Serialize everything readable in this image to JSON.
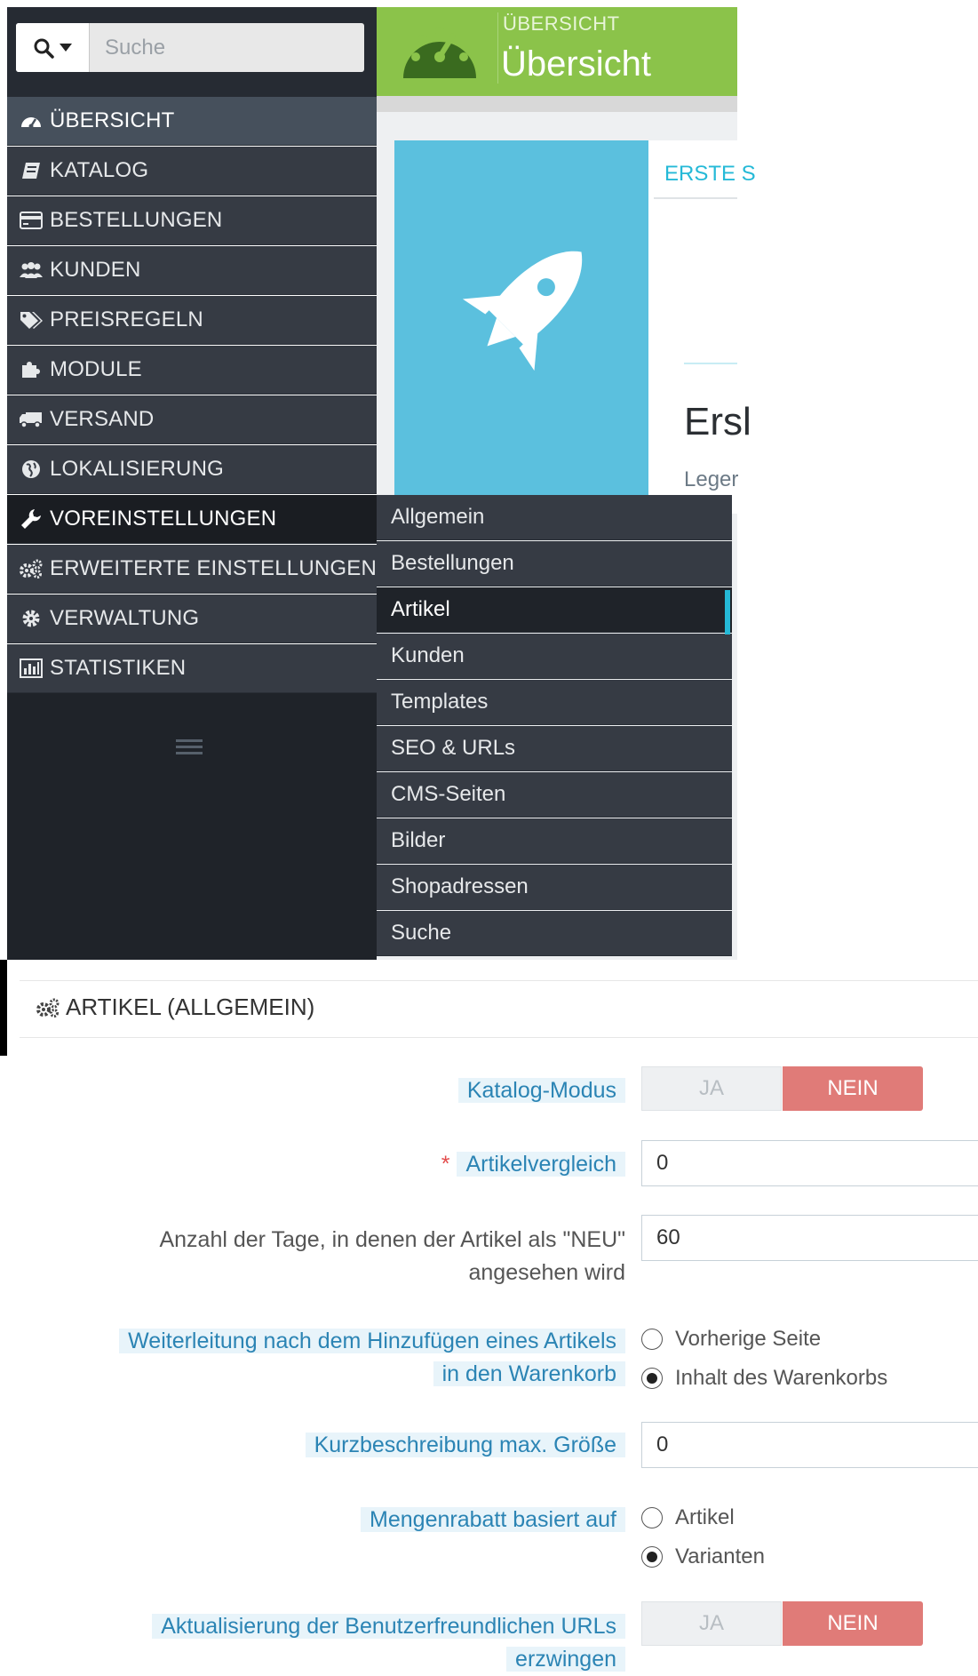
{
  "search": {
    "placeholder": "Suche"
  },
  "nav": {
    "items": [
      {
        "label": "ÜBERSICHT",
        "icon": "dashboard-icon"
      },
      {
        "label": "KATALOG",
        "icon": "book-icon"
      },
      {
        "label": "BESTELLUNGEN",
        "icon": "credit-card-icon"
      },
      {
        "label": "KUNDEN",
        "icon": "users-icon"
      },
      {
        "label": "PREISREGELN",
        "icon": "tags-icon"
      },
      {
        "label": "MODULE",
        "icon": "puzzle-icon"
      },
      {
        "label": "VERSAND",
        "icon": "truck-icon"
      },
      {
        "label": "LOKALISIERUNG",
        "icon": "globe-icon"
      },
      {
        "label": "VOREINSTELLUNGEN",
        "icon": "wrench-icon"
      },
      {
        "label": "ERWEITERTE EINSTELLUNGEN",
        "icon": "cogs-icon"
      },
      {
        "label": "VERWALTUNG",
        "icon": "cog-icon"
      },
      {
        "label": "STATISTIKEN",
        "icon": "bar-chart-icon"
      }
    ]
  },
  "submenu": {
    "items": [
      "Allgemein",
      "Bestellungen",
      "Artikel",
      "Kunden",
      "Templates",
      "SEO & URLs",
      "CMS-Seiten",
      "Bilder",
      "Shopadressen",
      "Suche"
    ],
    "active": "Artikel"
  },
  "header": {
    "breadcrumb": "ÜBERSICHT",
    "title": "Übersicht"
  },
  "panel": {
    "tab": "ERSTE S",
    "heading": "Ersl",
    "text": "Leger"
  },
  "form": {
    "title": "ARTIKEL (ALLGEMEIN)",
    "catalog_mode": {
      "label": "Katalog-Modus",
      "yes": "JA",
      "no": "NEIN",
      "value": "NEIN"
    },
    "compare": {
      "required_mark": "*",
      "label": "Artikelvergleich",
      "value": "0"
    },
    "new_days": {
      "label_line1": "Anzahl der Tage, in denen der Artikel als \"NEU\"",
      "label_line2": "angesehen wird",
      "value": "60"
    },
    "redirect": {
      "label_line1": "Weiterleitung nach dem Hinzufügen eines Artikels",
      "label_line2": "in den Warenkorb",
      "options": [
        "Vorherige Seite",
        "Inhalt des Warenkorbs"
      ],
      "selected": "Inhalt des Warenkorbs"
    },
    "short_desc": {
      "label": "Kurzbeschreibung max. Größe",
      "value": "0"
    },
    "quantity_discount": {
      "label": "Mengenrabatt basiert auf",
      "options": [
        "Artikel",
        "Varianten"
      ],
      "selected": "Varianten"
    },
    "force_friendly_url": {
      "label_line1": "Aktualisierung der Benutzerfreundlichen URLs",
      "label_line2": "erzwingen",
      "yes": "JA",
      "no": "NEIN",
      "value": "NEIN"
    }
  },
  "colors": {
    "sidebar": "#363b44",
    "sidebar_dark": "#1f2329",
    "header_green": "#8bc34a",
    "accent_blue": "#25b9d7",
    "rocket_bg": "#5bc0de",
    "toggle_no": "#e07b78",
    "label_highlight": "#e8f4fa",
    "label_text": "#2b84b4"
  }
}
